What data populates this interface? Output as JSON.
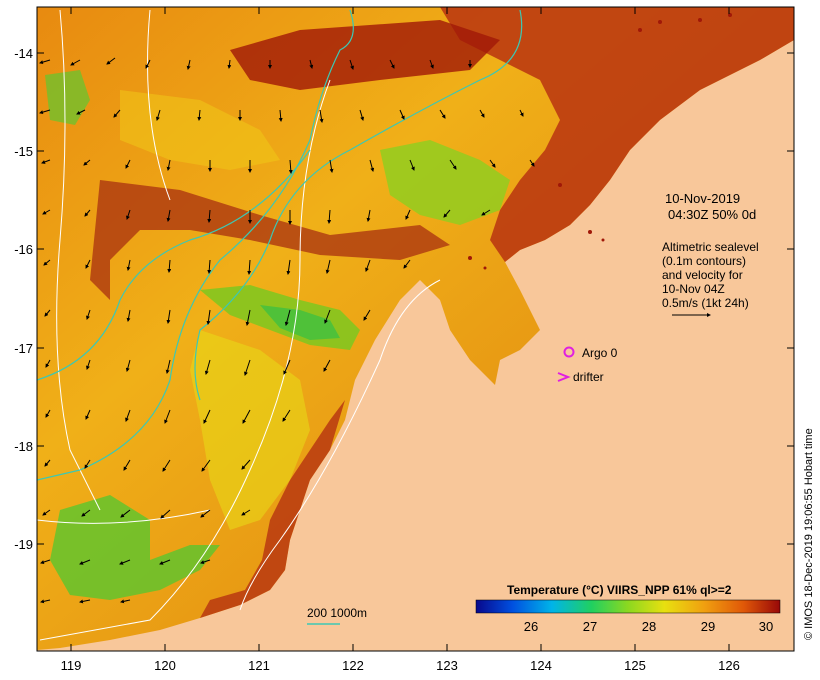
{
  "map": {
    "lat_ticks": [
      "-14",
      "-15",
      "-16",
      "-17",
      "-18",
      "-19"
    ],
    "lon_ticks": [
      "119",
      "120",
      "121",
      "122",
      "123",
      "124",
      "125",
      "126"
    ],
    "date_line": "10-Nov-2019",
    "time_line": "04:30Z  50% 0d",
    "info_lines": [
      "Altimetric sealevel",
      "(0.1m contours)",
      "and velocity for",
      "10-Nov 04Z",
      "0.5m/s (1kt 24h)"
    ],
    "argo_label": "Argo 0",
    "drifter_label": "drifter",
    "depth_legend": "200  1000m",
    "credit": "© IMOS 18-Dec-2019 19:06:55 Hobart time"
  },
  "colorbar": {
    "title": "Temperature (°C) VIIRS_NPP 61% ql>=2",
    "ticks": [
      "26",
      "27",
      "28",
      "29",
      "30"
    ]
  },
  "colors": {
    "land": "#f8c79a",
    "coast_warm": "#a01808",
    "shelf_contour": "#3cc8b4",
    "sealevel_contour": "#ffffff",
    "argo": "#e020e0"
  }
}
